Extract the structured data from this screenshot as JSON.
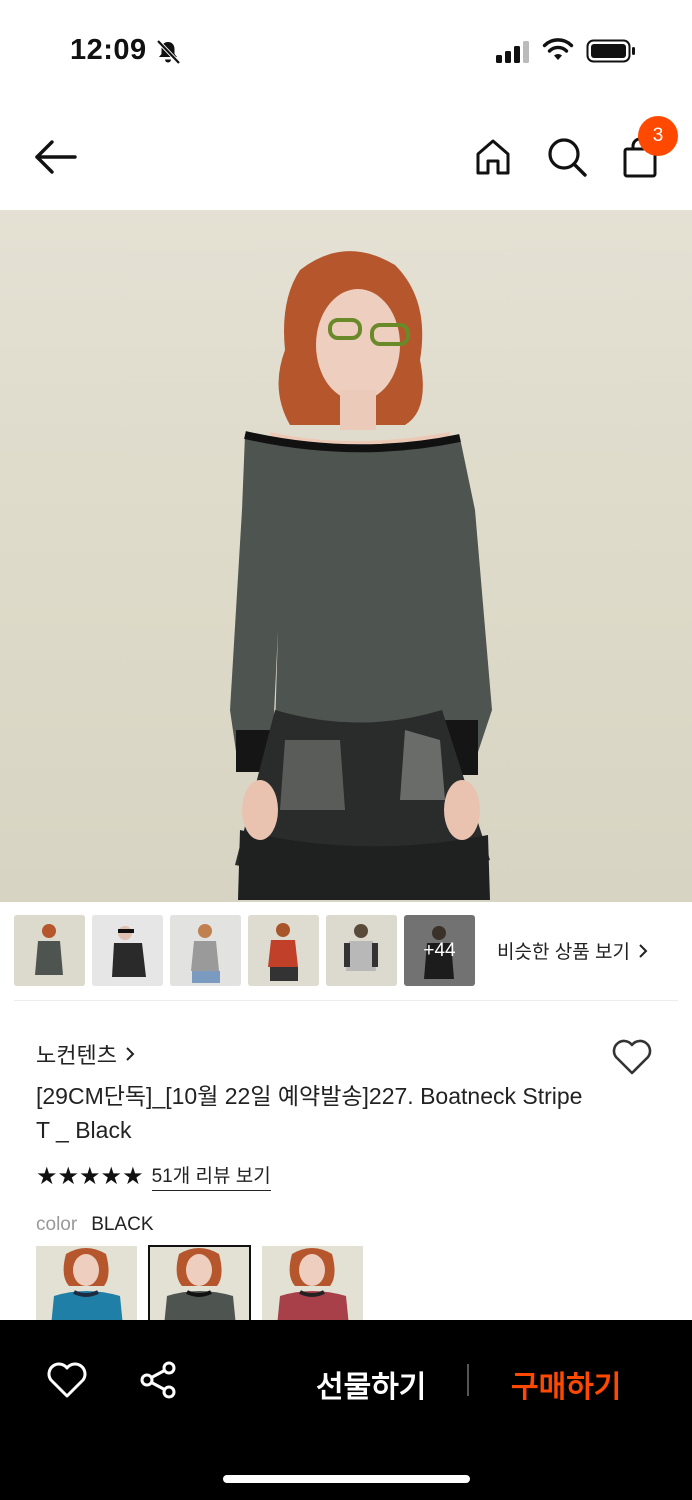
{
  "status_bar": {
    "time": "12:09"
  },
  "header": {
    "cart_count": "3"
  },
  "thumbnails": {
    "more_count": "+44",
    "similar_label": "비슷한 상품 보기"
  },
  "product": {
    "brand": "노컨텐츠",
    "title": "[29CM단독]_[10월 22일 예약발송]227. Boatneck Stripe T _ Black",
    "stars": "★★★★★",
    "rating_value": 5,
    "review_link": "51개 리뷰 보기",
    "color_label": "color",
    "color_value": "BLACK"
  },
  "bottom_bar": {
    "gift_label": "선물하기",
    "buy_label": "구매하기"
  },
  "colors": {
    "accent": "#ff4800",
    "bar": "#000000"
  }
}
